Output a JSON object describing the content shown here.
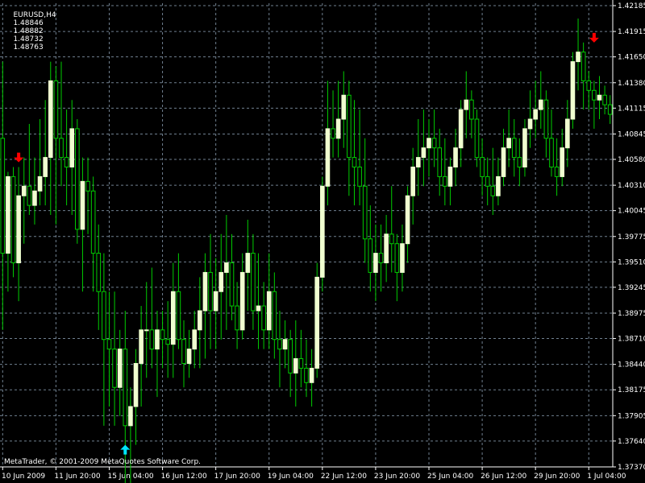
{
  "chart_header": {
    "symbol_timeframe": "EURUSD,H4",
    "bid": "1.48846",
    "high": "1.48882",
    "low": "1.48732",
    "close": "1.48763"
  },
  "footer": {
    "copyright": "MetaTrader, © 2001-2009 MetaQuotes Software Corp."
  },
  "colors": {
    "background": "#000000",
    "bull_candle": "#F0FFD0",
    "wick": "#00CC00",
    "grid": "#708090",
    "signal_down": "#FF0000",
    "signal_up": "#00E5FF"
  },
  "chart_data": {
    "type": "candlestick",
    "title": "",
    "xlabel": "",
    "ylabel": "",
    "ylim": [
      1.3737,
      1.4221
    ],
    "grid": true,
    "y_ticks": [
      "1.42185",
      "1.41915",
      "1.41650",
      "1.41380",
      "1.41115",
      "1.40845",
      "1.40580",
      "1.40310",
      "1.40045",
      "1.39775",
      "1.39510",
      "1.39245",
      "1.38975",
      "1.38710",
      "1.38440",
      "1.38175",
      "1.37905",
      "1.37640",
      "1.37370"
    ],
    "x_ticks": [
      "10 Jun 2009",
      "11 Jun 20:00",
      "15 Jun 04:00",
      "16 Jun 12:00",
      "17 Jun 20:00",
      "19 Jun 04:00",
      "22 Jun 12:00",
      "23 Jun 20:00",
      "25 Jun 04:00",
      "26 Jun 12:00",
      "29 Jun 20:00",
      "1 Jul 04:00"
    ],
    "x_tick_positions": [
      0,
      10,
      20,
      30,
      40,
      50,
      60,
      70,
      80,
      90,
      100,
      110
    ],
    "candles": [
      [
        1.408,
        1.416,
        1.388,
        1.396
      ],
      [
        1.396,
        1.4045,
        1.392,
        1.404
      ],
      [
        1.404,
        1.405,
        1.3935,
        1.395
      ],
      [
        1.395,
        1.405,
        1.391,
        1.402
      ],
      [
        1.402,
        1.406,
        1.397,
        1.403
      ],
      [
        1.403,
        1.4095,
        1.4,
        1.401
      ],
      [
        1.401,
        1.406,
        1.399,
        1.4025
      ],
      [
        1.4025,
        1.41,
        1.401,
        1.404
      ],
      [
        1.404,
        1.412,
        1.401,
        1.406
      ],
      [
        1.406,
        1.416,
        1.4,
        1.414
      ],
      [
        1.414,
        1.4155,
        1.399,
        1.408
      ],
      [
        1.408,
        1.416,
        1.403,
        1.406
      ],
      [
        1.406,
        1.411,
        1.401,
        1.405
      ],
      [
        1.405,
        1.412,
        1.4,
        1.409
      ],
      [
        1.409,
        1.41,
        1.397,
        1.3985
      ],
      [
        1.3985,
        1.406,
        1.392,
        1.4035
      ],
      [
        1.4035,
        1.406,
        1.398,
        1.4025
      ],
      [
        1.4025,
        1.404,
        1.392,
        1.396
      ],
      [
        1.396,
        1.399,
        1.388,
        1.392
      ],
      [
        1.392,
        1.396,
        1.378,
        1.387
      ],
      [
        1.387,
        1.392,
        1.38,
        1.386
      ],
      [
        1.386,
        1.392,
        1.378,
        1.382
      ],
      [
        1.382,
        1.388,
        1.379,
        1.386
      ],
      [
        1.386,
        1.39,
        1.372,
        1.378
      ],
      [
        1.378,
        1.382,
        1.372,
        1.38
      ],
      [
        1.38,
        1.386,
        1.376,
        1.3845
      ],
      [
        1.3845,
        1.3905,
        1.38,
        1.388
      ],
      [
        1.388,
        1.393,
        1.383,
        1.388
      ],
      [
        1.388,
        1.3945,
        1.384,
        1.386
      ],
      [
        1.386,
        1.39,
        1.381,
        1.388
      ],
      [
        1.388,
        1.39,
        1.384,
        1.387
      ],
      [
        1.387,
        1.391,
        1.383,
        1.3865
      ],
      [
        1.3865,
        1.395,
        1.383,
        1.392
      ],
      [
        1.392,
        1.396,
        1.386,
        1.387
      ],
      [
        1.387,
        1.389,
        1.382,
        1.3845
      ],
      [
        1.3845,
        1.388,
        1.383,
        1.386
      ],
      [
        1.386,
        1.39,
        1.384,
        1.388
      ],
      [
        1.388,
        1.3935,
        1.384,
        1.39
      ],
      [
        1.39,
        1.396,
        1.385,
        1.394
      ],
      [
        1.394,
        1.398,
        1.386,
        1.39
      ],
      [
        1.39,
        1.3955,
        1.386,
        1.392
      ],
      [
        1.392,
        1.398,
        1.387,
        1.394
      ],
      [
        1.394,
        1.4,
        1.388,
        1.395
      ],
      [
        1.395,
        1.398,
        1.389,
        1.3905
      ],
      [
        1.3905,
        1.393,
        1.386,
        1.388
      ],
      [
        1.388,
        1.396,
        1.387,
        1.394
      ],
      [
        1.394,
        1.3995,
        1.39,
        1.396
      ],
      [
        1.396,
        1.398,
        1.388,
        1.39
      ],
      [
        1.39,
        1.396,
        1.386,
        1.3905
      ],
      [
        1.3905,
        1.393,
        1.386,
        1.388
      ],
      [
        1.388,
        1.396,
        1.386,
        1.392
      ],
      [
        1.392,
        1.394,
        1.385,
        1.387
      ],
      [
        1.387,
        1.39,
        1.382,
        1.386
      ],
      [
        1.386,
        1.389,
        1.384,
        1.387
      ],
      [
        1.387,
        1.388,
        1.381,
        1.3835
      ],
      [
        1.3835,
        1.389,
        1.38,
        1.385
      ],
      [
        1.385,
        1.388,
        1.382,
        1.384
      ],
      [
        1.384,
        1.387,
        1.381,
        1.3825
      ],
      [
        1.3825,
        1.386,
        1.38,
        1.384
      ],
      [
        1.384,
        1.395,
        1.383,
        1.3935
      ],
      [
        1.3935,
        1.404,
        1.392,
        1.403
      ],
      [
        1.403,
        1.414,
        1.401,
        1.409
      ],
      [
        1.409,
        1.413,
        1.406,
        1.408
      ],
      [
        1.408,
        1.414,
        1.406,
        1.41
      ],
      [
        1.41,
        1.415,
        1.407,
        1.4125
      ],
      [
        1.4125,
        1.414,
        1.402,
        1.406
      ],
      [
        1.406,
        1.412,
        1.401,
        1.405
      ],
      [
        1.405,
        1.411,
        1.401,
        1.403
      ],
      [
        1.403,
        1.408,
        1.395,
        1.3975
      ],
      [
        1.3975,
        1.401,
        1.392,
        1.394
      ],
      [
        1.394,
        1.399,
        1.391,
        1.396
      ],
      [
        1.396,
        1.399,
        1.392,
        1.395
      ],
      [
        1.395,
        1.4,
        1.393,
        1.398
      ],
      [
        1.398,
        1.403,
        1.394,
        1.397
      ],
      [
        1.397,
        1.398,
        1.391,
        1.394
      ],
      [
        1.394,
        1.399,
        1.392,
        1.397
      ],
      [
        1.397,
        1.403,
        1.395,
        1.402
      ],
      [
        1.402,
        1.407,
        1.399,
        1.405
      ],
      [
        1.405,
        1.41,
        1.402,
        1.406
      ],
      [
        1.406,
        1.411,
        1.403,
        1.407
      ],
      [
        1.407,
        1.41,
        1.404,
        1.408
      ],
      [
        1.408,
        1.411,
        1.405,
        1.407
      ],
      [
        1.407,
        1.409,
        1.402,
        1.404
      ],
      [
        1.404,
        1.408,
        1.401,
        1.403
      ],
      [
        1.403,
        1.406,
        1.401,
        1.405
      ],
      [
        1.405,
        1.409,
        1.403,
        1.407
      ],
      [
        1.407,
        1.412,
        1.405,
        1.411
      ],
      [
        1.411,
        1.415,
        1.408,
        1.412
      ],
      [
        1.412,
        1.413,
        1.408,
        1.41
      ],
      [
        1.41,
        1.411,
        1.405,
        1.406
      ],
      [
        1.406,
        1.408,
        1.402,
        1.404
      ],
      [
        1.404,
        1.406,
        1.401,
        1.403
      ],
      [
        1.403,
        1.407,
        1.4,
        1.402
      ],
      [
        1.402,
        1.406,
        1.401,
        1.404
      ],
      [
        1.404,
        1.409,
        1.403,
        1.407
      ],
      [
        1.407,
        1.411,
        1.405,
        1.408
      ],
      [
        1.408,
        1.41,
        1.404,
        1.406
      ],
      [
        1.406,
        1.408,
        1.403,
        1.405
      ],
      [
        1.405,
        1.41,
        1.404,
        1.409
      ],
      [
        1.409,
        1.413,
        1.407,
        1.41
      ],
      [
        1.41,
        1.414,
        1.408,
        1.411
      ],
      [
        1.411,
        1.415,
        1.409,
        1.412
      ],
      [
        1.412,
        1.413,
        1.406,
        1.408
      ],
      [
        1.408,
        1.411,
        1.404,
        1.405
      ],
      [
        1.405,
        1.408,
        1.402,
        1.404
      ],
      [
        1.404,
        1.409,
        1.403,
        1.407
      ],
      [
        1.407,
        1.412,
        1.405,
        1.41
      ],
      [
        1.41,
        1.417,
        1.409,
        1.416
      ],
      [
        1.416,
        1.4205,
        1.413,
        1.417
      ],
      [
        1.417,
        1.418,
        1.411,
        1.414
      ],
      [
        1.414,
        1.415,
        1.411,
        1.413
      ],
      [
        1.413,
        1.414,
        1.409,
        1.412
      ],
      [
        1.412,
        1.4145,
        1.41,
        1.4125
      ],
      [
        1.4125,
        1.4135,
        1.4105,
        1.4115
      ],
      [
        1.4115,
        1.4125,
        1.4095,
        1.4105
      ]
    ],
    "signals": [
      {
        "index": 3,
        "type": "arrow-down",
        "price": 1.406
      },
      {
        "index": 23,
        "type": "arrow-up",
        "price": 1.3755
      },
      {
        "index": 111,
        "type": "arrow-down",
        "price": 1.4185
      }
    ]
  }
}
